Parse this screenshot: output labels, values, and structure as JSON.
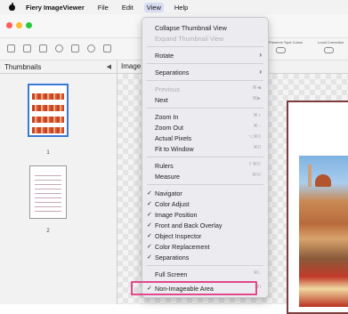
{
  "menubar": {
    "app_name": "Fiery ImageViewer",
    "menus": [
      "File",
      "Edit",
      "View",
      "Help"
    ]
  },
  "toolbar": {
    "right_labels": [
      "Preserve Spot Colors",
      "Local Correction"
    ]
  },
  "left_panel": {
    "title": "Thumbnails",
    "thumbnails": [
      {
        "number": "1",
        "selected": true
      },
      {
        "number": "2",
        "selected": false
      }
    ]
  },
  "canvas": {
    "header_label": "Image"
  },
  "view_menu": {
    "items": [
      {
        "label": "Collapse Thumbnail View",
        "enabled": true
      },
      {
        "label": "Expand Thumbnail View",
        "enabled": false
      },
      {
        "label": "Rotate",
        "enabled": true,
        "submenu": true
      },
      {
        "label": "Separations",
        "enabled": true,
        "submenu": true
      },
      {
        "label": "Previous",
        "enabled": false,
        "shortcut": "⌘◀"
      },
      {
        "label": "Next",
        "enabled": true,
        "shortcut": "⌘▶"
      },
      {
        "label": "Zoom In",
        "enabled": true,
        "shortcut": "⌘+"
      },
      {
        "label": "Zoom Out",
        "enabled": true,
        "shortcut": "⌘−"
      },
      {
        "label": "Actual Pixels",
        "enabled": true,
        "shortcut": "⌥⌘0"
      },
      {
        "label": "Fit to Window",
        "enabled": true,
        "shortcut": "⌘0"
      },
      {
        "label": "Rulers",
        "enabled": true,
        "shortcut": "⇧⌘R"
      },
      {
        "label": "Measure",
        "enabled": true,
        "shortcut": "⌘M"
      },
      {
        "label": "Navigator",
        "enabled": true,
        "checked": true
      },
      {
        "label": "Color Adjust",
        "enabled": true,
        "checked": true
      },
      {
        "label": "Image Position",
        "enabled": true,
        "checked": true
      },
      {
        "label": "Front and Back Overlay",
        "enabled": true,
        "checked": true
      },
      {
        "label": "Object Inspector",
        "enabled": true,
        "checked": true
      },
      {
        "label": "Color Replacement",
        "enabled": true,
        "checked": true
      },
      {
        "label": "Separations",
        "enabled": true,
        "checked": true
      },
      {
        "label": "Full Screen",
        "enabled": true,
        "shortcut": "⌘L"
      },
      {
        "label": "Non-Imageable Area",
        "enabled": true,
        "checked": true,
        "shortcut": "⌘I"
      }
    ],
    "highlight_color": "#e2478a"
  },
  "colors": {
    "traffic_red": "#ff5f57",
    "traffic_yellow": "#febc2e",
    "traffic_green": "#28c840",
    "selection_blue": "#3a79d6",
    "page_border": "#7a3c3c"
  }
}
